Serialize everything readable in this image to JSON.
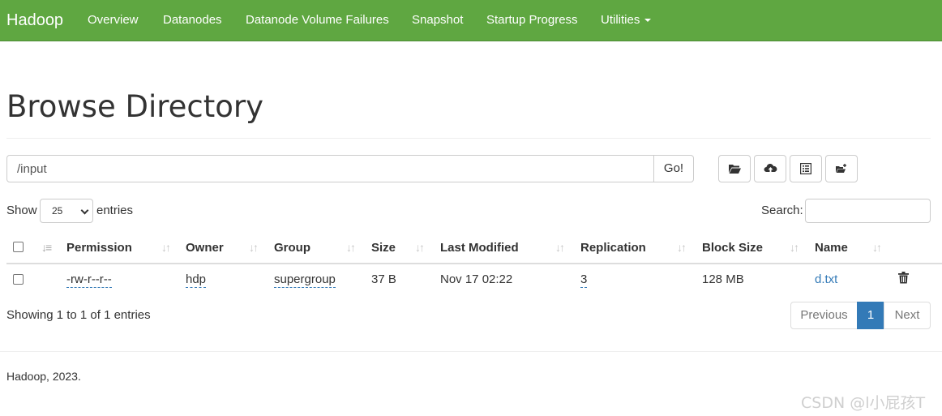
{
  "navbar": {
    "brand": "Hadoop",
    "items": [
      {
        "label": "Overview"
      },
      {
        "label": "Datanodes"
      },
      {
        "label": "Datanode Volume Failures"
      },
      {
        "label": "Snapshot"
      },
      {
        "label": "Startup Progress"
      },
      {
        "label": "Utilities"
      }
    ],
    "accent_color": "#5fa741"
  },
  "page": {
    "title": "Browse Directory"
  },
  "path_bar": {
    "value": "/input",
    "go_label": "Go!"
  },
  "toolbar": {
    "buttons": [
      {
        "icon": "folder-open-icon"
      },
      {
        "icon": "cloud-upload-icon"
      },
      {
        "icon": "list-alt-icon"
      },
      {
        "icon": "paste-icon"
      }
    ]
  },
  "table_controls": {
    "show_label": "Show",
    "entries_value": "25",
    "entries_label": "entries",
    "search_label": "Search:"
  },
  "table": {
    "headers": [
      "Permission",
      "Owner",
      "Group",
      "Size",
      "Last Modified",
      "Replication",
      "Block Size",
      "Name"
    ],
    "rows": [
      {
        "permission": "-rw-r--r--",
        "owner": "hdp",
        "group": "supergroup",
        "size": "37 B",
        "last_modified": "Nov 17 02:22",
        "replication": "3",
        "block_size": "128 MB",
        "name": "d.txt"
      }
    ]
  },
  "pagination": {
    "status": "Showing 1 to 1 of 1 entries",
    "previous": "Previous",
    "current": "1",
    "next": "Next",
    "active_color": "#337ab7"
  },
  "footer": {
    "text": "Hadoop, 2023."
  },
  "watermark": "CSDN @l小屁孩T"
}
